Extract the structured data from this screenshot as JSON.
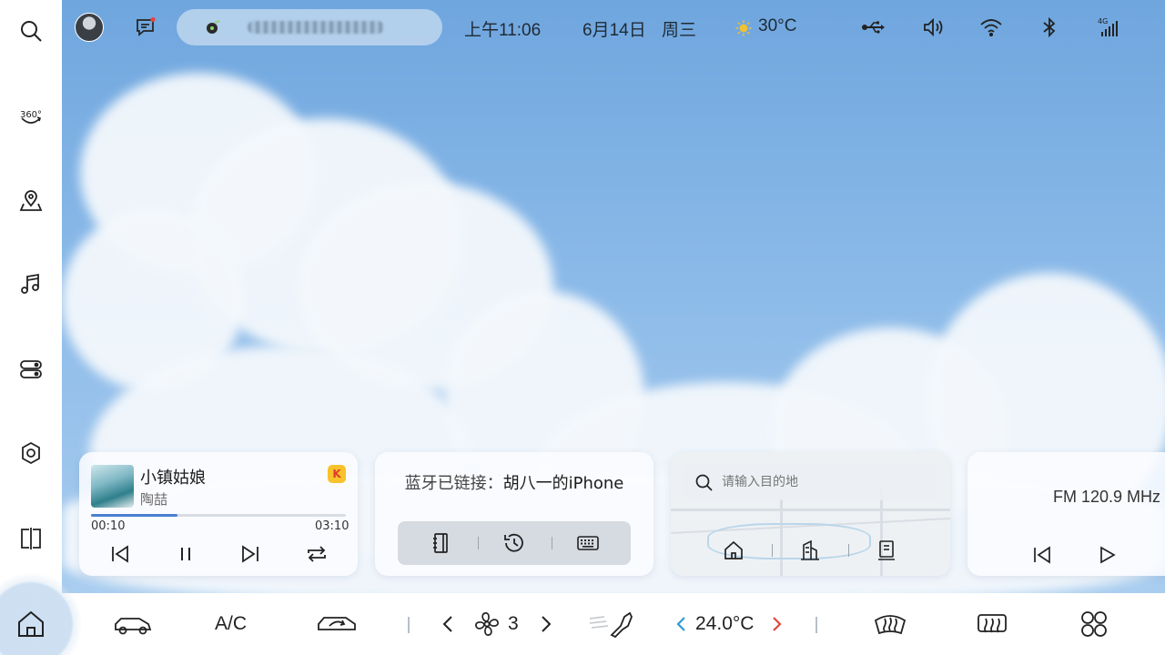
{
  "status_bar": {
    "time": "上午11:06",
    "date": "6月14日",
    "weekday": "周三",
    "weather_icon": "sun-icon",
    "temperature": "30°C",
    "icons": [
      "usb-icon",
      "volume-icon",
      "wifi-icon",
      "bluetooth-icon",
      "signal-4g-icon"
    ],
    "signal_label": "4G"
  },
  "sidebar": {
    "items": [
      "search-icon",
      "camera-360-icon",
      "navigation-icon",
      "music-icon",
      "toggle-controls-icon",
      "settings-icon",
      "split-screen-icon"
    ],
    "label_360": "360°"
  },
  "music": {
    "title": "小镇姑娘",
    "artist": "陶喆",
    "badge": "K",
    "elapsed": "00:10",
    "duration": "03:10",
    "progress_fraction": 0.34
  },
  "bluetooth": {
    "prefix": "蓝牙已链接：",
    "device": "胡八一的iPhone"
  },
  "navigation": {
    "search_placeholder": "请输入目的地"
  },
  "radio": {
    "station": "FM 120.9 MHz"
  },
  "dock": {
    "ac_label": "A/C",
    "fan_level": "3",
    "temperature": "24.0°C"
  },
  "colors": {
    "accent_blue": "#4a7fd0",
    "temp_down": "#2f9bd6",
    "temp_up": "#e0463a",
    "badge_yellow": "#f7c22b"
  }
}
